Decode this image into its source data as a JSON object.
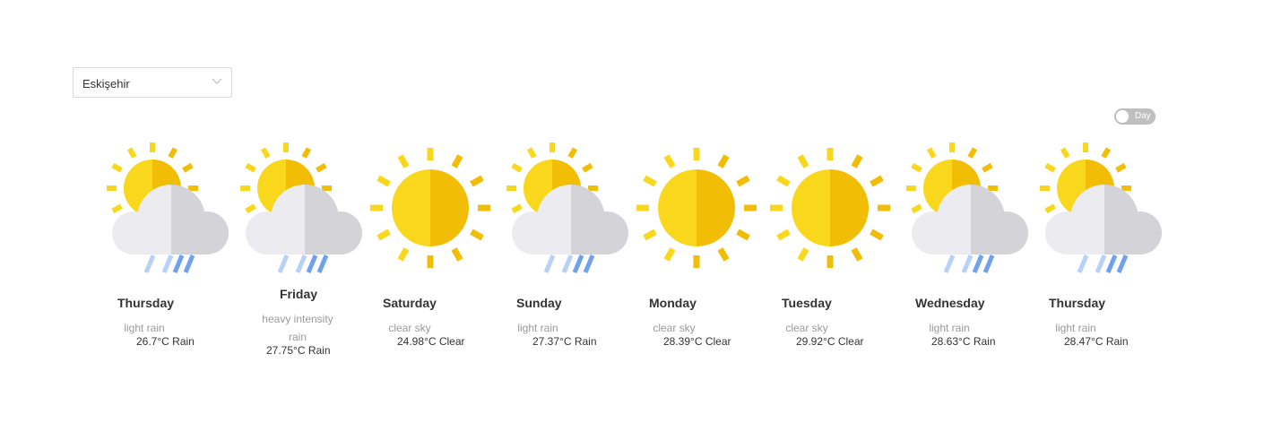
{
  "city_select": {
    "value": "Eskişehir"
  },
  "toggle": {
    "label": "Day",
    "checked": false
  },
  "colors": {
    "sun_light": "#f8d71c",
    "sun_dark": "#f2bd05",
    "cloud_light": "#ebebf0",
    "cloud_dark": "#d4d3d8",
    "rain_light": "#b8d1fb",
    "rain_dark": "#6fa1ef"
  },
  "days": [
    {
      "name": "Thursday",
      "description": "light rain",
      "temp": "26.7°C",
      "main": "Rain",
      "icon": "rain-icon"
    },
    {
      "name": "Friday",
      "description": "heavy intensity rain",
      "temp": "27.75°C",
      "main": "Rain",
      "icon": "rain-icon"
    },
    {
      "name": "Saturday",
      "description": "clear sky",
      "temp": "24.98°C",
      "main": "Clear",
      "icon": "sun-icon"
    },
    {
      "name": "Sunday",
      "description": "light rain",
      "temp": "27.37°C",
      "main": "Rain",
      "icon": "rain-icon"
    },
    {
      "name": "Monday",
      "description": "clear sky",
      "temp": "28.39°C",
      "main": "Clear",
      "icon": "sun-icon"
    },
    {
      "name": "Tuesday",
      "description": "clear sky",
      "temp": "29.92°C",
      "main": "Clear",
      "icon": "sun-icon"
    },
    {
      "name": "Wednesday",
      "description": "light rain",
      "temp": "28.63°C",
      "main": "Rain",
      "icon": "rain-icon"
    },
    {
      "name": "Thursday",
      "description": "light rain",
      "temp": "28.47°C",
      "main": "Rain",
      "icon": "rain-icon"
    }
  ]
}
